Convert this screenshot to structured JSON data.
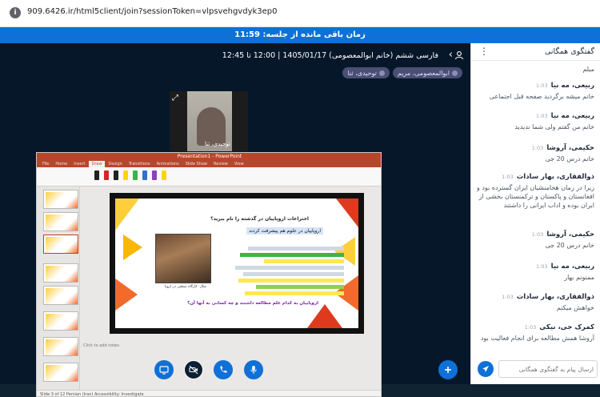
{
  "browser": {
    "url": "909.6426.ir/html5client/join?sessionToken=vlpsvehgvdyk3ep0"
  },
  "timer": {
    "text": "زمان باقی مانده از جلسه: 11:59"
  },
  "meeting": {
    "title": "فارسی ششم (خانم ابوالمعصومی) 1405/01/17 | 12:00 تا 12:45",
    "presenters": [
      "ابوالمعصومی، مریم",
      "توحیدی، ثنا"
    ]
  },
  "webcam": {
    "label": "توحیدی، ثنا"
  },
  "slide": {
    "heading": "اختراعات اروپاییان در گذشته را نام ببرید؟",
    "subtitle": "اروپاییان در علوم هم پیشرفت کردند",
    "footer": "اروپاییان به کدام علم مطالعه داشتند و چه کسانی به آنها آن؟",
    "caption": "مثال: کارگاه صنعتی در اروپا",
    "notes": "Click to add notes"
  },
  "ppt": {
    "window_title": "Presentation1 - PowerPoint",
    "tabs": [
      "File",
      "Home",
      "Insert",
      "Draw",
      "Design",
      "Transitions",
      "Animations",
      "Slide Show",
      "Review",
      "View"
    ],
    "status": "Slide 3 of 12   Persian (Iran)   Accessibility: Investigate"
  },
  "chat": {
    "title": "گفتگوی همگانی",
    "messages": [
      {
        "name": "",
        "time": "",
        "text": "میلم"
      },
      {
        "name": "ربیعی، مه نیا",
        "time": "1:03",
        "text": "خانم میشه برگردید صفحه قبل اجتماعی"
      },
      {
        "name": "ربیعی، مه نیا",
        "time": "1:03",
        "text": "خانم من گفتم ولی شما ندیدید"
      },
      {
        "name": "حکیمی، آروشا",
        "time": "1:03",
        "text": "خانم درس 20 جی"
      },
      {
        "name": "ذوالفقاری، بهار سادات",
        "time": "1:03",
        "text": "زیرا در زمان هخامنشیان ایران گسترده بود و افغانستان و پاکستان و ترکمنستان بخشی از ایران بوده و اداب ایرانی را داشتند"
      },
      {
        "name": "حکیمی، آروشا",
        "time": "1:03",
        "text": "خانم درس 20 جی"
      },
      {
        "name": "ربیعی، مه نیا",
        "time": "1:03",
        "text": "ممنونم بهار"
      },
      {
        "name": "ذوالفقاری، بهار سادات",
        "time": "1:03",
        "text": "خواهش میکنم"
      },
      {
        "name": "کمرک جی، نیکی",
        "time": "1:03",
        "text": "آروشا همش مطالعه برای انجام فعالیت بود"
      }
    ],
    "input_placeholder": "ارسال پیام به گفتگوی همگانی"
  },
  "colors": {
    "primary": "#0f70d7",
    "main_bg": "#06172a",
    "ppt_accent": "#b7472a"
  }
}
